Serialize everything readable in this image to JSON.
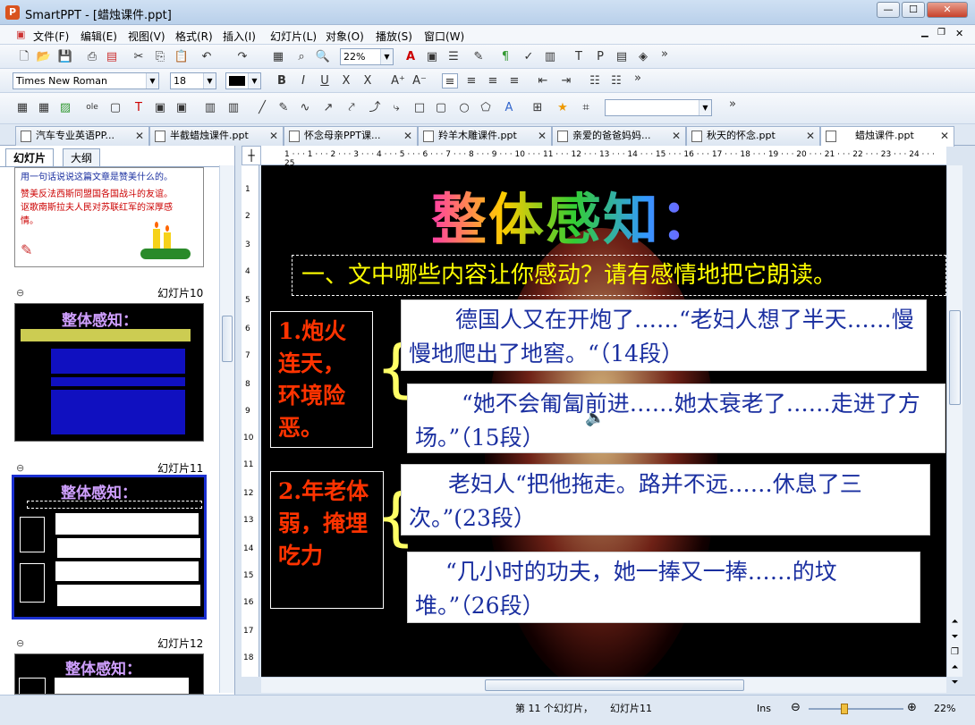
{
  "window": {
    "app": "SmartPPT",
    "title": "SmartPPT - [蜡烛课件.ppt]"
  },
  "menu": [
    "文件(F)",
    "编辑(E)",
    "视图(V)",
    "格式(R)",
    "插入(I)",
    "幻灯片(L)",
    "对象(O)",
    "播放(S)",
    "窗口(W)"
  ],
  "toolbar": {
    "zoom": "22%",
    "font": "Times New Roman",
    "size": "18"
  },
  "tabs": [
    "汽车专业英语PP...",
    "半截蜡烛课件.ppt",
    "怀念母亲PPT课...",
    "羚羊木雕课件.ppt",
    "亲爱的爸爸妈妈...",
    "秋天的怀念.ppt",
    "蜡烛课件.ppt"
  ],
  "panel": {
    "tab1": "幻灯片",
    "tab2": "大纲"
  },
  "thumbs": {
    "t9_line1": "用一句话说说这篇文章是赞美什么的。",
    "t9_line2": "赞美反法西斯同盟国各国战斗的友谊。讴歌南斯拉夫人民对苏联红军的深厚感情。",
    "s10": "幻灯片10",
    "s11": "幻灯片11",
    "s12": "幻灯片12",
    "t10_title": "整体感知：",
    "t11_title": "整体感知：",
    "t12_title": "整体感知："
  },
  "slide": {
    "title": "整体感知：",
    "question": "一、文中哪些内容让你感动？请有感情地把它朗读。",
    "label1": "1.炮火连天，环境险恶。",
    "label2": "2.年老体弱，掩埋吃力",
    "q1": "德国人又在开炮了……“老妇人想了半天……慢慢地爬出了地窖。“（14段）",
    "q2": "“她不会匍匐前进……她太衰老了……走进了方场。”（15段）",
    "q3": "老妇人“把他拖走。路并不远……休息了三次。”(23段）",
    "q4": "“几小时的功夫，她一捧又一捧……的坟堆。”（26段）"
  },
  "status": {
    "pos": "第 11 个幻灯片，",
    "name": "幻灯片11",
    "ins": "Ins",
    "zoom": "22%"
  }
}
